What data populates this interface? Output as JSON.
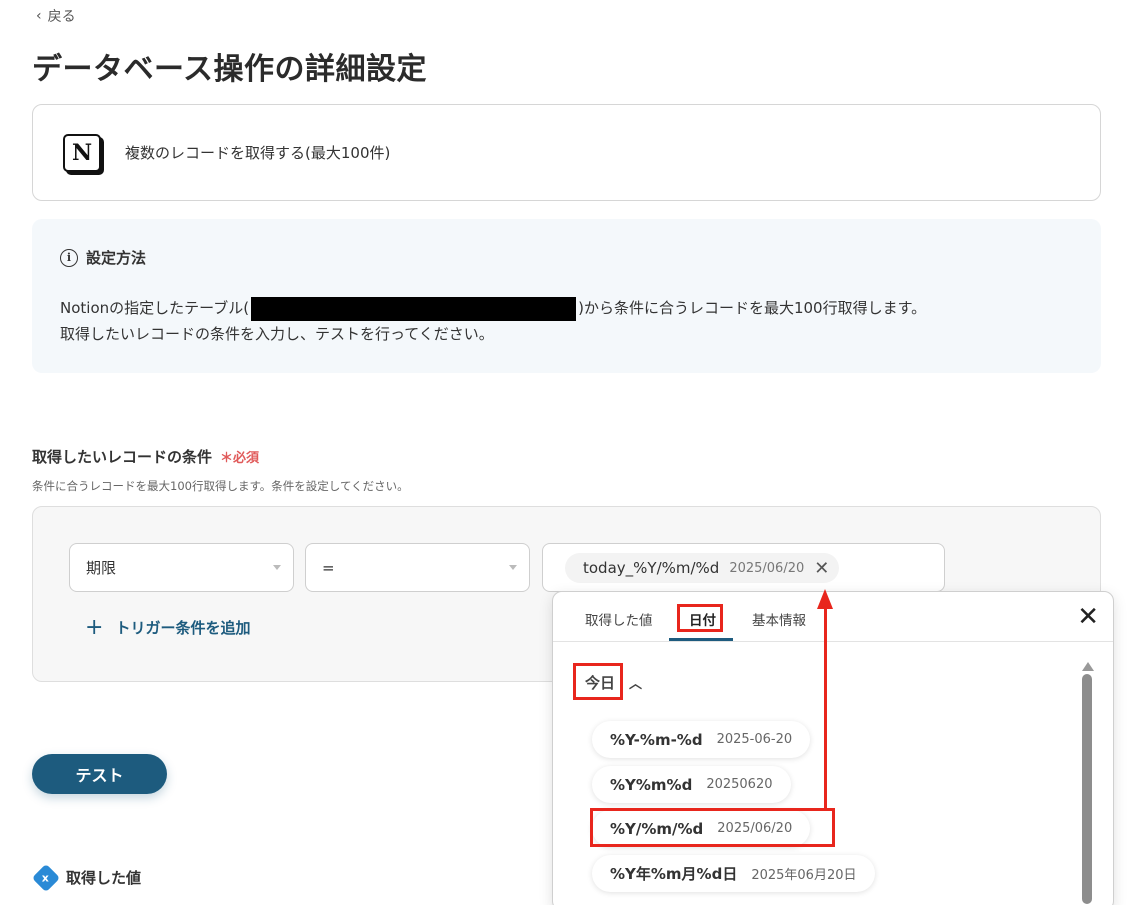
{
  "nav": {
    "back_label": "戻る"
  },
  "page": {
    "title": "データベース操作の詳細設定"
  },
  "app_card": {
    "logo_letter": "N",
    "action": "複数のレコードを取得する(最大100件)"
  },
  "info": {
    "heading": "設定方法",
    "line1_before": "Notionの指定したテーブル(",
    "line1_after": ")から条件に合うレコードを最大100行取得します。",
    "line2": "取得したいレコードの条件を入力し、テストを行ってください。"
  },
  "conditions": {
    "label": "取得したいレコードの条件",
    "required": "＊必須",
    "sub": "条件に合うレコードを最大100行取得します。条件を設定してください。",
    "field_value": "期限",
    "operator_value": "=",
    "chip_key": "today_%Y/%m/%d",
    "chip_value": "2025/06/20",
    "add_label": "トリガー条件を追加"
  },
  "test_button": "テスト",
  "got_values": {
    "label": "取得した値"
  },
  "popup": {
    "tabs": [
      "取得した値",
      "日付",
      "基本情報"
    ],
    "section": "今日",
    "options": [
      {
        "key": "%Y-%m-%d",
        "value": "2025-06-20"
      },
      {
        "key": "%Y%m%d",
        "value": "20250620"
      },
      {
        "key": "%Y/%m/%d",
        "value": "2025/06/20"
      },
      {
        "key": "%Y年%m月%d日",
        "value": "2025年06月20日"
      }
    ]
  },
  "colors": {
    "accent": "#1d5b7e",
    "highlight": "#e8261d",
    "required": "#e05a5a"
  }
}
